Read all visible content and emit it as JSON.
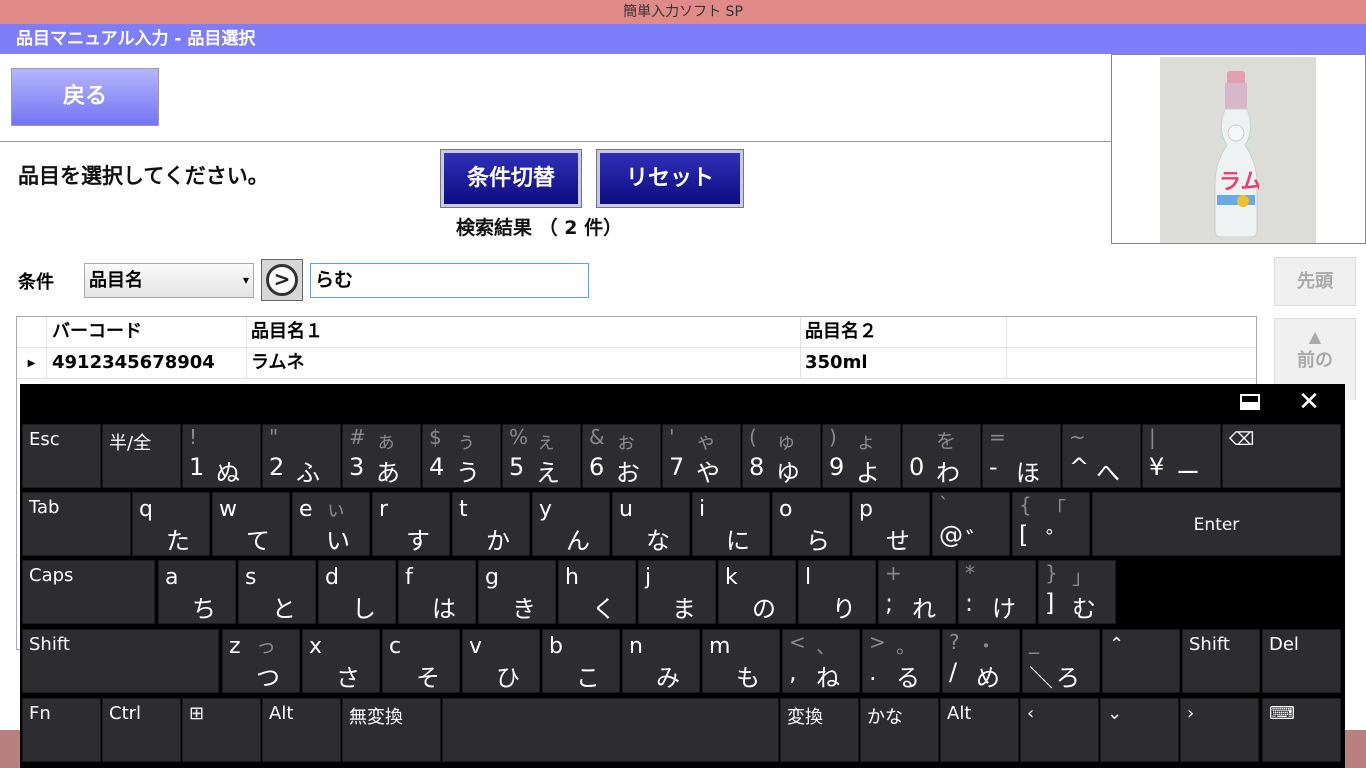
{
  "app": {
    "title": "簡単入力ソフト SP",
    "subheader": "品目マニュアル入力 - 品目選択",
    "back_label": "戻る",
    "prompt": "品目を選択してください。",
    "toggle_label": "条件切替",
    "reset_label": "リセット",
    "result_text": "検索結果 （ 2 件）"
  },
  "search": {
    "condition_label": "条件",
    "field_value": "品目名",
    "go_icon": "arrow-right-circle-icon",
    "query": "らむ"
  },
  "side": {
    "first_label": "先頭",
    "prev_label": "前の",
    "prev_icon": "triangle-up-icon"
  },
  "grid": {
    "headers": [
      "バーコード",
      "品目名１",
      "品目名２"
    ],
    "rows": [
      {
        "barcode": "4912345678904",
        "name1": "ラムネ",
        "name2": "350ml"
      }
    ],
    "row_marker_icon": "row-pointer-icon"
  },
  "photo": {
    "icon": "ramune-bottle-image",
    "label": "ラムネ"
  },
  "keyboard": {
    "dock_icon": "dock-icon",
    "close_icon": "close-icon",
    "row1": [
      {
        "label": "Esc"
      },
      {
        "label": "半/全"
      },
      {
        "sh": "!",
        "shk": "",
        "ch": "1",
        "kana": "ぬ"
      },
      {
        "sh": "\"",
        "shk": "",
        "ch": "2",
        "kana": "ふ"
      },
      {
        "sh": "#",
        "shk": "ぁ",
        "ch": "3",
        "kana": "あ"
      },
      {
        "sh": "$",
        "shk": "ぅ",
        "ch": "4",
        "kana": "う"
      },
      {
        "sh": "%",
        "shk": "ぇ",
        "ch": "5",
        "kana": "え"
      },
      {
        "sh": "&",
        "shk": "ぉ",
        "ch": "6",
        "kana": "お"
      },
      {
        "sh": "'",
        "shk": "ゃ",
        "ch": "7",
        "kana": "や"
      },
      {
        "sh": "(",
        "shk": "ゅ",
        "ch": "8",
        "kana": "ゆ"
      },
      {
        "sh": ")",
        "shk": "ょ",
        "ch": "9",
        "kana": "よ"
      },
      {
        "sh": "",
        "shk": "を",
        "ch": "0",
        "kana": "わ"
      },
      {
        "sh": "=",
        "shk": "",
        "ch": "-",
        "kana": "ほ"
      },
      {
        "sh": "~",
        "shk": "",
        "ch": "^",
        "kana": "へ"
      },
      {
        "sh": "|",
        "shk": "",
        "ch": "¥",
        "kana": "ー"
      },
      {
        "label": "⌫"
      }
    ],
    "row2": [
      {
        "label": "Tab"
      },
      {
        "lat": "q",
        "shk": "",
        "kana": "た"
      },
      {
        "lat": "w",
        "shk": "",
        "kana": "て"
      },
      {
        "lat": "e",
        "shk": "ぃ",
        "kana": "い"
      },
      {
        "lat": "r",
        "shk": "",
        "kana": "す"
      },
      {
        "lat": "t",
        "shk": "",
        "kana": "か"
      },
      {
        "lat": "y",
        "shk": "",
        "kana": "ん"
      },
      {
        "lat": "u",
        "shk": "",
        "kana": "な"
      },
      {
        "lat": "i",
        "shk": "",
        "kana": "に"
      },
      {
        "lat": "o",
        "shk": "",
        "kana": "ら"
      },
      {
        "lat": "p",
        "shk": "",
        "kana": "せ"
      },
      {
        "sh": "`",
        "shk": "",
        "ch": "@",
        "kana": "゛"
      },
      {
        "sh": "{",
        "shk": "「",
        "ch": "[",
        "kana": "゜"
      },
      {
        "label": "Enter"
      }
    ],
    "row3": [
      {
        "label": "Caps"
      },
      {
        "lat": "a",
        "shk": "",
        "kana": "ち"
      },
      {
        "lat": "s",
        "shk": "",
        "kana": "と"
      },
      {
        "lat": "d",
        "shk": "",
        "kana": "し"
      },
      {
        "lat": "f",
        "shk": "",
        "kana": "は"
      },
      {
        "lat": "g",
        "shk": "",
        "kana": "き"
      },
      {
        "lat": "h",
        "shk": "",
        "kana": "く"
      },
      {
        "lat": "j",
        "shk": "",
        "kana": "ま"
      },
      {
        "lat": "k",
        "shk": "",
        "kana": "の"
      },
      {
        "lat": "l",
        "shk": "",
        "kana": "り"
      },
      {
        "sh": "+",
        "shk": "",
        "ch": ";",
        "kana": "れ"
      },
      {
        "sh": "*",
        "shk": "",
        "ch": ":",
        "kana": "け"
      },
      {
        "sh": "}",
        "shk": "」",
        "ch": "]",
        "kana": "む"
      }
    ],
    "row4": [
      {
        "label": "Shift"
      },
      {
        "lat": "z",
        "shk": "っ",
        "kana": "つ"
      },
      {
        "lat": "x",
        "shk": "",
        "kana": "さ"
      },
      {
        "lat": "c",
        "shk": "",
        "kana": "そ"
      },
      {
        "lat": "v",
        "shk": "",
        "kana": "ひ"
      },
      {
        "lat": "b",
        "shk": "",
        "kana": "こ"
      },
      {
        "lat": "n",
        "shk": "",
        "kana": "み"
      },
      {
        "lat": "m",
        "shk": "",
        "kana": "も"
      },
      {
        "sh": "<",
        "shk": "、",
        "ch": ",",
        "kana": "ね"
      },
      {
        "sh": ">",
        "shk": "。",
        "ch": ".",
        "kana": "る"
      },
      {
        "sh": "?",
        "shk": "・",
        "ch": "/",
        "kana": "め"
      },
      {
        "sh": "_",
        "shk": "",
        "ch": "＼",
        "kana": "ろ"
      },
      {
        "label": "⌃"
      },
      {
        "label": "Shift"
      },
      {
        "label": "Del"
      }
    ],
    "row5": [
      {
        "label": "Fn"
      },
      {
        "label": "Ctrl"
      },
      {
        "label": "⊞"
      },
      {
        "label": "Alt"
      },
      {
        "label": "無変換"
      },
      {
        "label": ""
      },
      {
        "label": "変換"
      },
      {
        "label": "かな"
      },
      {
        "label": "Alt"
      },
      {
        "label": "‹"
      },
      {
        "label": "⌄"
      },
      {
        "label": "›"
      },
      {
        "label": "⌨"
      }
    ]
  }
}
